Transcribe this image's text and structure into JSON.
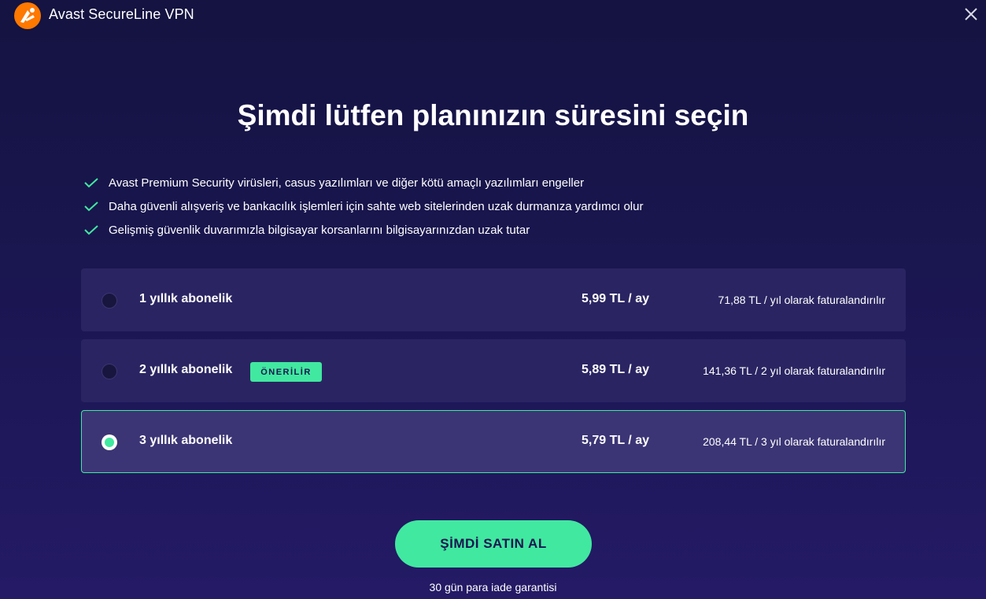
{
  "app": {
    "title": "Avast SecureLine VPN",
    "close_icon": "close-icon",
    "logo_icon": "avast-logo-icon"
  },
  "main": {
    "heading": "Şimdi lütfen planınızın süresini seçin",
    "features": [
      "Avast Premium Security virüsleri, casus yazılımları ve diğer kötü amaçlı yazılımları engeller",
      "Daha güvenli alışveriş ve bankacılık işlemleri için sahte web sitelerinden uzak durmanıza yardımcı olur",
      "Gelişmiş güvenlik duvarımızla bilgisayar korsanlarını bilgisayarınızdan uzak tutar"
    ],
    "plans": [
      {
        "name": "1 yıllık abonelik",
        "price": "5,99 TL / ay",
        "billing": "71,88 TL / yıl olarak faturalandırılır",
        "selected": false
      },
      {
        "name": "2 yıllık abonelik",
        "badge": "ÖNERİLİR",
        "price": "5,89 TL / ay",
        "billing": "141,36 TL / 2 yıl olarak faturalandırılır",
        "selected": false
      },
      {
        "name": "3 yıllık abonelik",
        "price": "5,79 TL / ay",
        "billing": "208,44 TL / 3 yıl olarak faturalandırılır",
        "selected": true
      }
    ],
    "buy_button": "ŞİMDİ SATIN AL",
    "guarantee": "30 gün para iade garantisi"
  },
  "colors": {
    "background": "#1a1650",
    "card": "#2a2562",
    "card_selected": "#3b3575",
    "accent": "#41e8a0",
    "logo": "#ff7800"
  }
}
